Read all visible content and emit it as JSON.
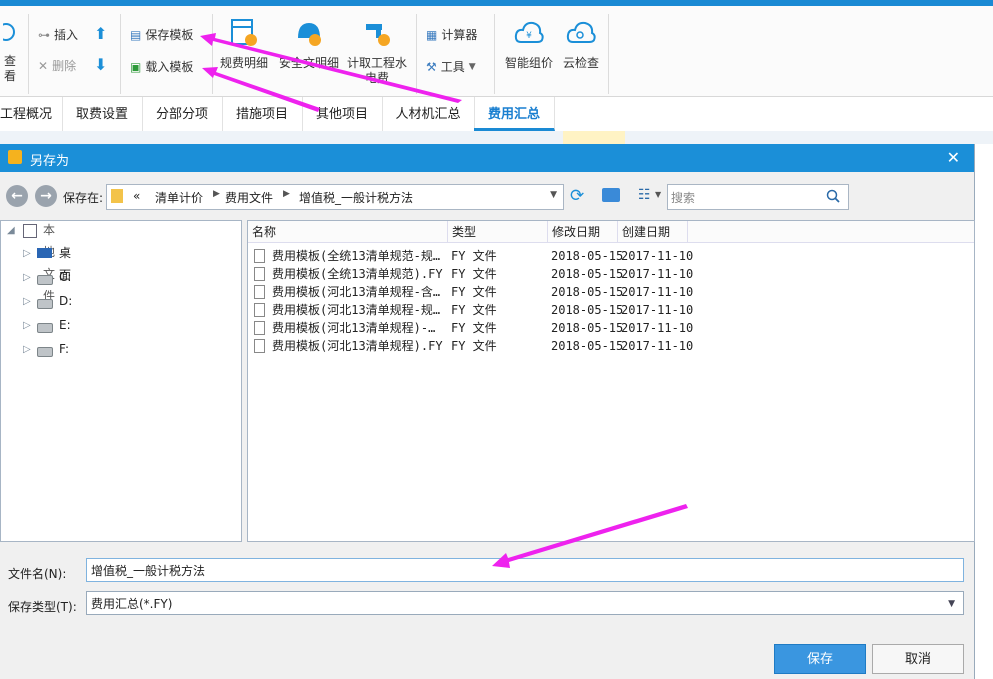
{
  "ribbon": {
    "view_label": "查看",
    "insert_label": "插入",
    "delete_label": "删除",
    "save_template_label": "保存模板",
    "load_template_label": "载入模板",
    "fee_detail_label": "规费明细",
    "civil_label": "安全文明细",
    "water_label": "计取工程水电费",
    "calculator_label": "计算器",
    "tools_label": "工具",
    "smart_price_label": "智能组价",
    "cloud_check_label": "云检查"
  },
  "tabs": [
    "工程概况",
    "取费设置",
    "分部分项",
    "措施项目",
    "其他项目",
    "人材机汇总",
    "费用汇总"
  ],
  "active_tab": "费用汇总",
  "dialog": {
    "title": "另存为",
    "save_in_label": "保存在:",
    "path": [
      "«",
      "清单计价",
      "费用文件",
      "增值税_一般计税方法"
    ],
    "search_placeholder": "搜索",
    "tree": {
      "root": "本地文件",
      "items": [
        "桌面",
        "C:",
        "D:",
        "E:",
        "F:"
      ]
    },
    "columns": [
      "名称",
      "类型",
      "修改日期",
      "创建日期"
    ],
    "files": [
      {
        "name": "费用模板(全统13清单规范-规…",
        "type": "FY 文件",
        "modified": "2018-05-15",
        "created": "2017-11-10"
      },
      {
        "name": "费用模板(全统13清单规范).FY",
        "type": "FY 文件",
        "modified": "2018-05-15",
        "created": "2017-11-10"
      },
      {
        "name": "费用模板(河北13清单规程-含…",
        "type": "FY 文件",
        "modified": "2018-05-15",
        "created": "2017-11-10"
      },
      {
        "name": "费用模板(河北13清单规程-规…",
        "type": "FY 文件",
        "modified": "2018-05-15",
        "created": "2017-11-10"
      },
      {
        "name": "费用模板(河北13清单规程)-…",
        "type": "FY 文件",
        "modified": "2018-05-15",
        "created": "2017-11-10"
      },
      {
        "name": "费用模板(河北13清单规程).FY",
        "type": "FY 文件",
        "modified": "2018-05-15",
        "created": "2017-11-10"
      }
    ],
    "filename_label": "文件名(N):",
    "filename_value": "增值税_一般计税方法",
    "filetype_label": "保存类型(T):",
    "filetype_value": "费用汇总(*.FY)",
    "save_button": "保存",
    "cancel_button": "取消"
  },
  "colors": {
    "accent": "#1b8fd8",
    "arrow": "#ee22ee"
  }
}
